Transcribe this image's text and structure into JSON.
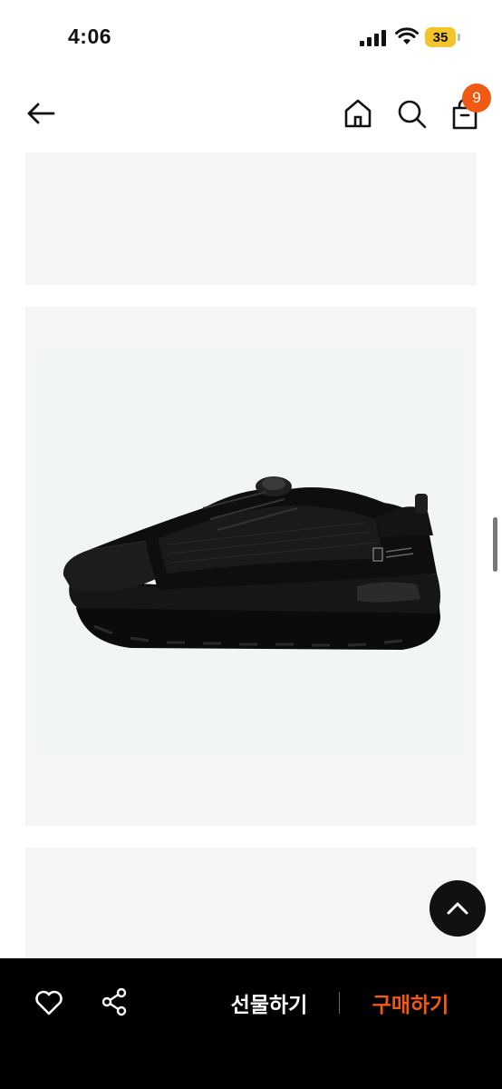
{
  "status_bar": {
    "time": "4:06",
    "battery_level": "35",
    "icons": [
      "signal-icon",
      "wifi-icon",
      "battery-icon"
    ]
  },
  "header": {
    "icons": [
      "back-arrow-icon",
      "home-icon",
      "search-icon",
      "shopping-bag-icon"
    ],
    "cart_badge_count": "9"
  },
  "content": {
    "product_image_icon": "black-sneaker"
  },
  "bottom_bar": {
    "gift_label": "선물하기",
    "buy_label": "구매하기",
    "icons": [
      "heart-icon",
      "share-icon"
    ]
  },
  "scroll_top_icon": "chevron-up-icon",
  "colors": {
    "accent": "#f15a12",
    "bottom_bar_bg": "#000000",
    "card_bg": "#f4f5f6",
    "battery": "#f3c52b"
  }
}
